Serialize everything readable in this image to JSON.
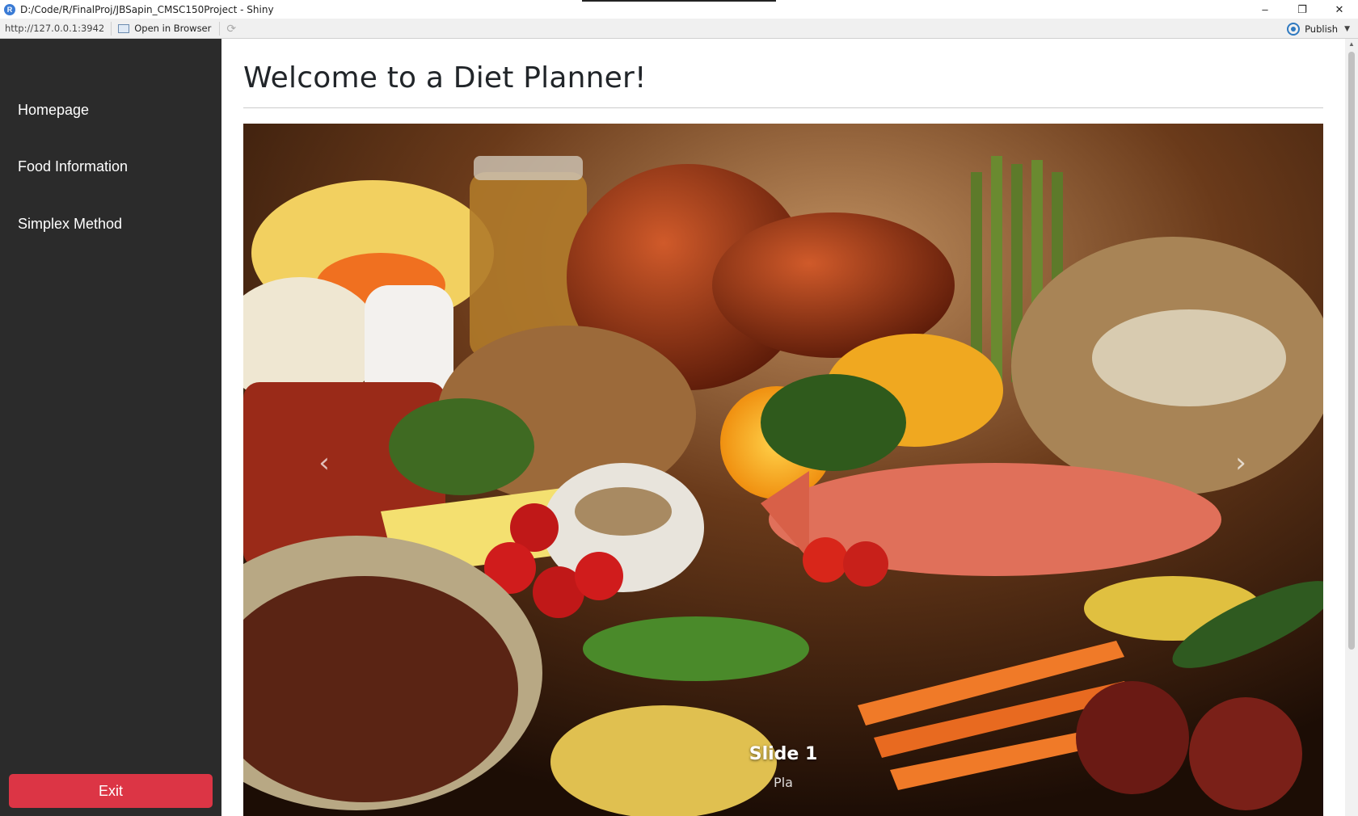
{
  "window": {
    "title": "D:/Code/R/FinalProj/JBSapin_CMSC150Project - Shiny",
    "app_icon_letter": "R",
    "controls": {
      "minimize": "–",
      "restore": "❐",
      "close": "✕"
    }
  },
  "addressbar": {
    "url": "http://127.0.0.1:3942",
    "open_in_browser": "Open in Browser",
    "publish": "Publish"
  },
  "sidebar": {
    "items": [
      {
        "label": "Homepage"
      },
      {
        "label": "Food Information"
      },
      {
        "label": "Simplex Method"
      }
    ],
    "exit_label": "Exit"
  },
  "main": {
    "title": "Welcome to a Diet Planner!",
    "carousel": {
      "prev_icon": "‹",
      "next_icon": "›",
      "caption_title": "Slide 1",
      "caption_sub": "Pla"
    }
  },
  "colors": {
    "sidebar_bg": "#2b2b2b",
    "exit_button": "#dc3545",
    "title_text": "#212529"
  }
}
